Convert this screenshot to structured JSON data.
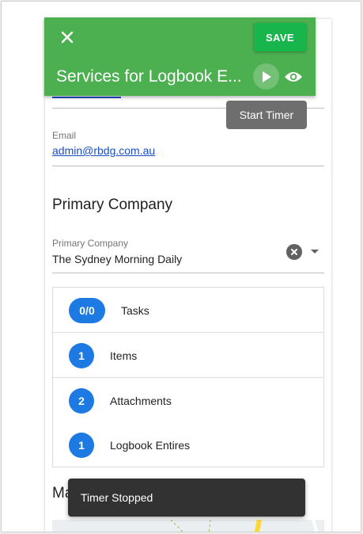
{
  "header": {
    "title": "Services for Logbook E...",
    "save_label": "SAVE",
    "close_icon": "close-icon",
    "play_icon": "play-icon",
    "eye_icon": "eye-icon"
  },
  "tooltip": {
    "text": "Start Timer"
  },
  "email": {
    "label": "Email",
    "value": "admin@rbdg.com.au"
  },
  "primary_company": {
    "section_title": "Primary Company",
    "field_label": "Primary Company",
    "value": "The Sydney Morning Daily"
  },
  "items_list": [
    {
      "badge": "0/0",
      "label": "Tasks"
    },
    {
      "badge": "1",
      "label": "Items"
    },
    {
      "badge": "2",
      "label": "Attachments"
    },
    {
      "badge": "1",
      "label": "Logbook Entires"
    }
  ],
  "map": {
    "section_title_partial": "Ma"
  },
  "snackbar": {
    "text": "Timer Stopped"
  },
  "colors": {
    "appbar": "#4caf50",
    "save_button": "#18b44c",
    "badge": "#1e7ae3",
    "link": "#1a4fc4",
    "snackbar": "#323232"
  }
}
